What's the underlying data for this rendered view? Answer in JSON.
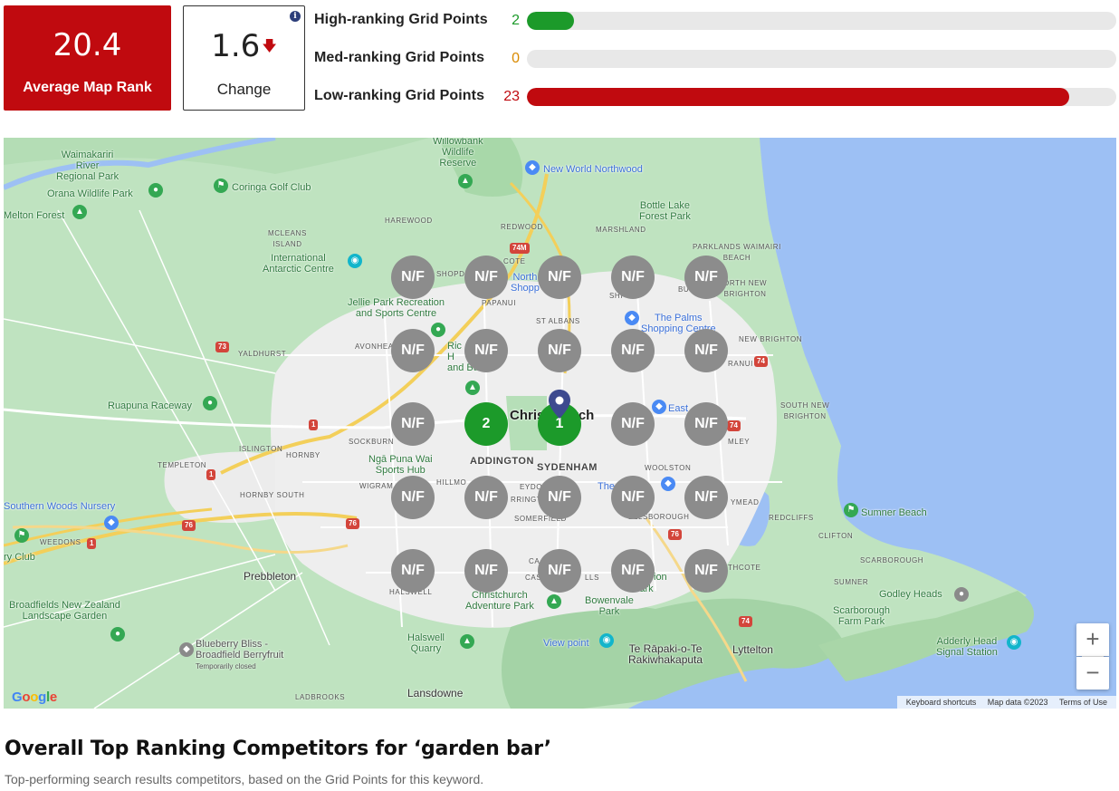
{
  "stats": {
    "average_rank": {
      "value": "20.4",
      "label": "Average Map Rank"
    },
    "change": {
      "value": "1.6",
      "direction_icon": "arrow-down-icon",
      "label": "Change"
    }
  },
  "ranking_bars": [
    {
      "label": "High-ranking Grid Points",
      "count": "2",
      "fraction": 0.08,
      "color": "#1c9a2a"
    },
    {
      "label": "Med-ranking Grid Points",
      "count": "0",
      "fraction": 0.0,
      "color": "#d98a00"
    },
    {
      "label": "Low-ranking Grid Points",
      "count": "23",
      "fraction": 0.92,
      "color": "#c00a0f"
    }
  ],
  "map": {
    "labels": {
      "willowbank": "Willowbank\nWildlife\nReserve",
      "waimakariri": "Waimakariri\nRiver\nRegional Park",
      "orana": "Orana Wildlife Park",
      "melton": "Melton Forest",
      "coringa": "Coringa Golf Club",
      "new_world": "New World Northwood",
      "bottle_lake": "Bottle Lake\nForest Park",
      "harewood": "HAREWOOD",
      "redwood": "REDWOOD",
      "marshland": "MARSHLAND",
      "mcleans": "MCLEANS\nISLAND",
      "parklands": "PARKLANDS WAIMAIRI\nBEACH",
      "intl_antarctic": "International\nAntarctic Centre",
      "northlands": "North\nShopp",
      "papanui": "PAPANUI",
      "north_brighton": "ORTH NEW\nBRIGHTON",
      "jellie": "Jellie Park Recreation\nand Sports Centre",
      "st_albans": "ST ALBANS",
      "the_palms": "The Palms\nShopping Centre",
      "new_brighton": "NEW BRIGHTON",
      "avonhead": "AVONHEA",
      "yaldhurst": "YALDHURST",
      "ruapuna": "Ruapuna Raceway",
      "christchurch": "Christchurch",
      "eastgate": "East",
      "south_new_brighton": "SOUTH NEW\nBRIGHTON",
      "islington": "ISLINGTON",
      "hornby": "HORNBY",
      "sockburn": "SOCKBURN",
      "nga_puna": "Ngā Puna Wai\nSports Hub",
      "addington": "ADDINGTON",
      "sydenham": "SYDENHAM",
      "woolston": "WOOLSTON",
      "templeton": "TEMPLETON",
      "hornby_south": "HORNBY SOUTH",
      "wigram": "WIGRAM",
      "southern_woods": "Southern Woods Nursery",
      "somerfield": "SOMERFIELD",
      "ellsborough": "ELLSBOROUGH",
      "redcliffs": "REDCLIFFS",
      "sumner_beach": "Sumner Beach",
      "clifton": "CLIFTON",
      "scarborough": "SCARBOROUGH",
      "weedons": "WEEDONS",
      "ry_club": "ry Club",
      "prebbleton": "Prebbleton",
      "halswell_sub": "HALSWELL",
      "adventure_park": "Christchurch\nAdventure Park",
      "bowenvale": "Bowenvale\nPark",
      "sumner": "SUMNER",
      "godley": "Godley Heads",
      "scarborough_farm": "Scarborough\nFarm Park",
      "broadfields": "Broadfields New Zealand\nLandscape Garden",
      "blueberry": "Blueberry Bliss -\nBroadfield Berryfruit",
      "blueberry_closed": "Temporarily closed",
      "halswell_quarry": "Halswell\nQuarry",
      "view_point": "View point",
      "te_rapaki": "Te Rāpaki-o-Te\nRakiwhakaputa",
      "lyttelton": "Lyttelton",
      "adderley": "Adderly Head\nSignal Station",
      "ladbrooks": "LADBROOKS",
      "lansdowne": "Lansdowne",
      "riccarton_bush": "Ric\nH\nand Bush",
      "hillmorton": "HILLMO",
      "sydenham_rr": "RRINGT",
      "beckenham": "EYDON",
      "heathcote": "THCOTE",
      "ferrymead": "YMEAD",
      "bromley": "MLEY",
      "aranui": "RANUI",
      "shirley": "SHI",
      "burwood": "BU",
      "shopda": "SHOPDA",
      "cashmere": "CA",
      "cashmere2": "CAS",
      "the_tannery": "The",
      "hills": "LLS",
      "avon_heath": "ion",
      "park_lbl": "Park",
      "dlc": "COTE"
    },
    "grid": [
      [
        "N/F",
        "N/F",
        "N/F",
        "N/F",
        "N/F"
      ],
      [
        "N/F",
        "N/F",
        "N/F",
        "N/F",
        "N/F"
      ],
      [
        "N/F",
        "2",
        "1",
        "N/F",
        "N/F"
      ],
      [
        "N/F",
        "N/F",
        "N/F",
        "N/F",
        "N/F"
      ],
      [
        "N/F",
        "N/F",
        "N/F",
        "N/F",
        "N/F"
      ]
    ],
    "zoom_in": "+",
    "zoom_out": "−",
    "google": "Google",
    "attribution": [
      "Keyboard shortcuts",
      "Map data ©2023",
      "Terms of Use"
    ]
  },
  "section": {
    "title": "Overall Top Ranking Competitors for ‘garden bar’",
    "subtitle": "Top-performing search results competitors, based on the Grid Points for this keyword."
  }
}
